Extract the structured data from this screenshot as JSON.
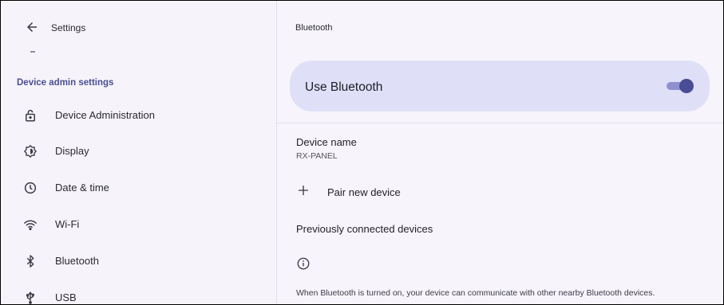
{
  "left_pane": {
    "top_title": "Settings",
    "section_header": "Device admin settings",
    "items": [
      {
        "label": "Device Administration",
        "icon": "lock-open-icon"
      },
      {
        "label": "Display",
        "icon": "brightness-icon"
      },
      {
        "label": "Date & time",
        "icon": "clock-icon"
      },
      {
        "label": "Wi-Fi",
        "icon": "wifi-icon"
      },
      {
        "label": "Bluetooth",
        "icon": "bluetooth-icon"
      },
      {
        "label": "USB",
        "icon": "usb-icon"
      }
    ]
  },
  "right_pane": {
    "title": "Bluetooth",
    "toggle": {
      "label": "Use Bluetooth",
      "on": true
    },
    "device_name": {
      "label": "Device name",
      "value": "RX-PANEL"
    },
    "pair_new_device": "Pair new device",
    "previously_connected": "Previously connected devices",
    "footer": "When Bluetooth is turned on, your device can communicate with other nearby Bluetooth devices."
  },
  "colors": {
    "accent": "#4a4d93",
    "toggle_card_bg": "#dfe0f8",
    "switch_track": "#8f90d1",
    "switch_thumb": "#4a4c95",
    "background": "#f7f5fb"
  }
}
